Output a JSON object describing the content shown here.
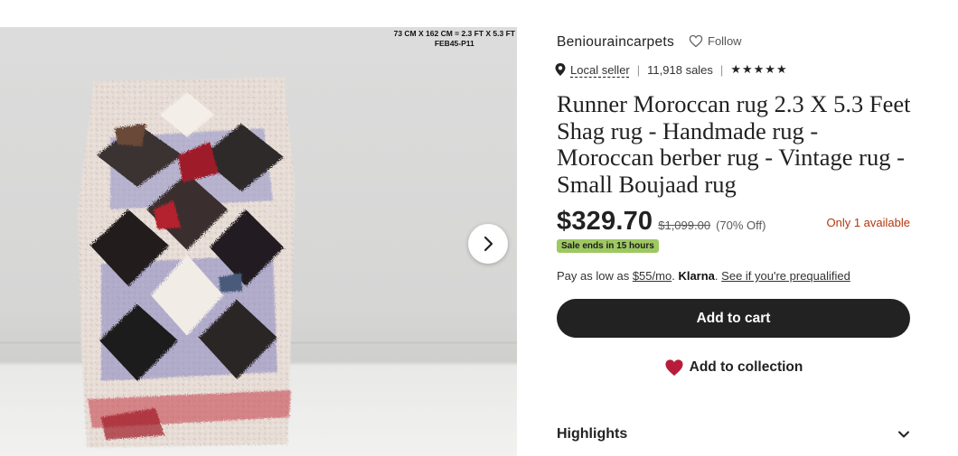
{
  "listing_image": {
    "caption_line1": "73 CM X 162 CM = 2.3 FT X 5.3 FT",
    "caption_line2": "FEB45-P11",
    "next_icon": "chevron-right-icon"
  },
  "shop": {
    "name": "Beniouraincarpets",
    "follow_label": "Follow",
    "follow_icon": "heart-outline-icon"
  },
  "seller_meta": {
    "location_icon": "map-pin-icon",
    "local_seller_label": "Local seller",
    "sales": "11,918 sales",
    "rating_stars": 5
  },
  "product": {
    "title": "Runner Moroccan rug 2.3 X 5.3 Feet Shag rug - Handmade rug - Moroccan berber rug - Vintage rug - Small Boujaad rug",
    "price": "$329.70",
    "original_price": "$1,099.00",
    "discount": "(70% Off)",
    "availability": "Only 1 available",
    "sale_badge": "Sale ends in 15 hours"
  },
  "payment": {
    "prefix": "Pay as low as",
    "installment": "$55/mo",
    "klarna": "Klarna",
    "prequalify_link": "See if you're prequalified"
  },
  "actions": {
    "add_to_cart": "Add to cart",
    "add_to_collection": "Add to collection",
    "collection_icon": "heart-filled-icon"
  },
  "sections": {
    "highlights": "Highlights"
  },
  "colors": {
    "primary_button": "#222222",
    "sale_badge": "#9ec861",
    "availability": "#b5360c",
    "collection_heart": "#b91c3a"
  }
}
